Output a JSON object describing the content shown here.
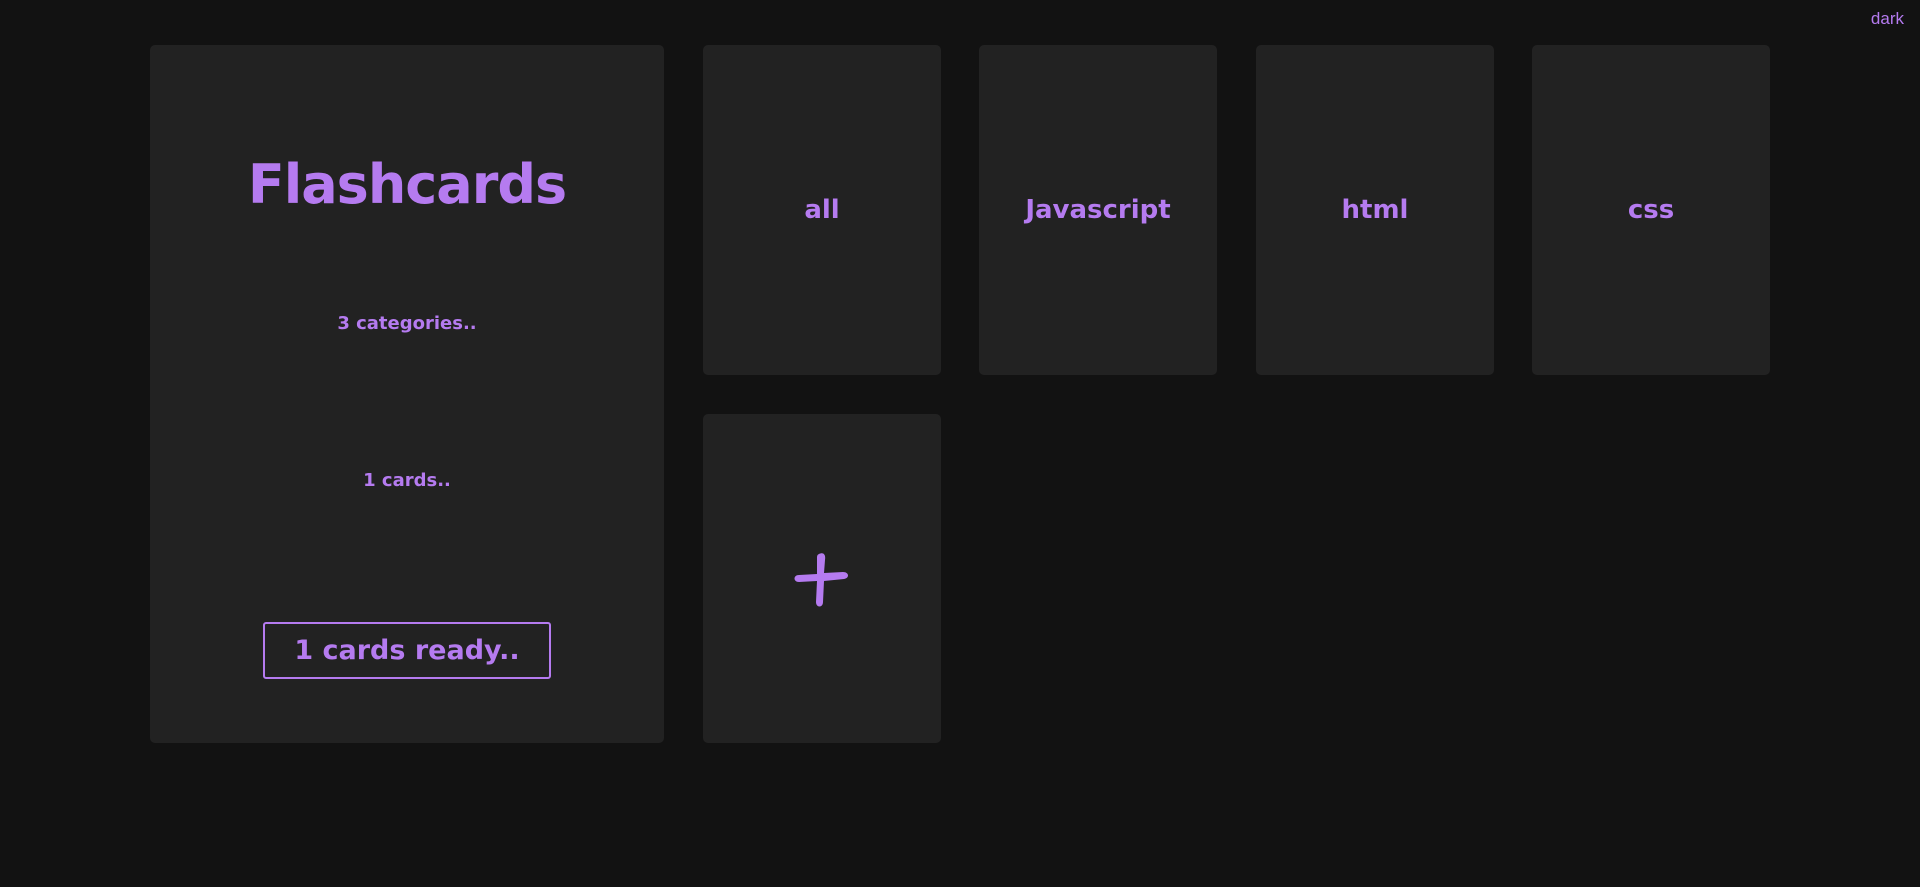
{
  "header": {
    "theme_label": "dark"
  },
  "summary": {
    "title": "Flashcards",
    "categories_text": "3 categories..",
    "cards_text": "1 cards..",
    "ready_button": "1 cards ready.."
  },
  "categories": [
    {
      "label": "all"
    },
    {
      "label": "Javascript"
    },
    {
      "label": "html"
    },
    {
      "label": "css"
    }
  ],
  "add_card": {
    "icon": "plus-icon"
  },
  "colors": {
    "background": "#121212",
    "panel": "#222222",
    "accent": "#b57bf0"
  }
}
